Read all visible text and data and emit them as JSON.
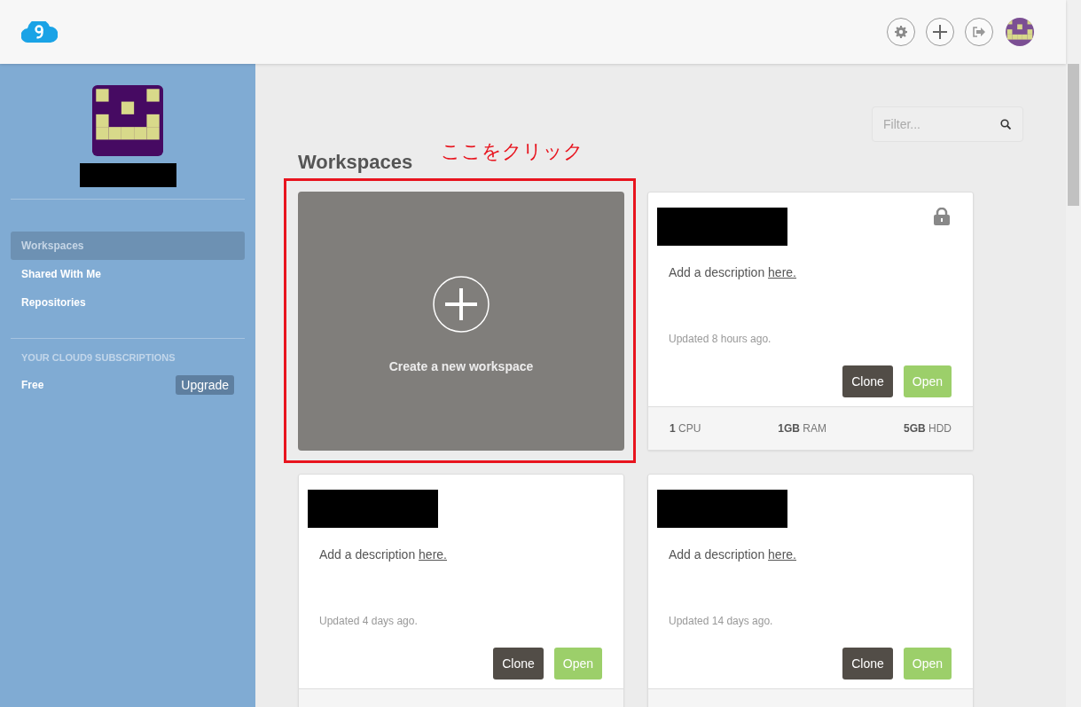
{
  "topbar": {
    "actions": [
      {
        "kind": "settings"
      },
      {
        "kind": "add"
      },
      {
        "kind": "logout"
      },
      {
        "kind": "avatar"
      }
    ]
  },
  "sidebar": {
    "items": [
      {
        "label": "Workspaces",
        "selected": true
      },
      {
        "label": "Shared With Me",
        "selected": false
      },
      {
        "label": "Repositories",
        "selected": false
      }
    ],
    "subscriptions": {
      "heading": "YOUR CLOUD9 SUBSCRIPTIONS",
      "plan": "Free",
      "button": "Upgrade"
    }
  },
  "main": {
    "filter": {
      "placeholder": "Filter..."
    },
    "title": "Workspaces",
    "annotation": "ここをクリック",
    "create_card": {
      "label": "Create a new workspace"
    },
    "workspaces": [
      {
        "locked": true,
        "description": "Add a description ",
        "link": "here.",
        "updated": "Updated 8 hours ago.",
        "buttons": [
          {
            "label": "Clone",
            "kind": "secondary"
          },
          {
            "label": "Open",
            "kind": "primary"
          }
        ],
        "specs": [
          "**1** CPU",
          "**1GB** RAM",
          "**5GB** HDD"
        ]
      },
      {
        "locked": false,
        "description": "Add a description ",
        "link": "here.",
        "updated": "Updated 4 days ago.",
        "buttons": [
          {
            "label": "Clone",
            "kind": "secondary"
          },
          {
            "label": "Open",
            "kind": "primary"
          }
        ]
      },
      {
        "locked": false,
        "description": "Add a description ",
        "link": "here.",
        "updated": "Updated 14 days ago.",
        "buttons": [
          {
            "label": "Clone",
            "kind": "secondary"
          },
          {
            "label": "Open",
            "kind": "primary"
          }
        ]
      }
    ]
  }
}
